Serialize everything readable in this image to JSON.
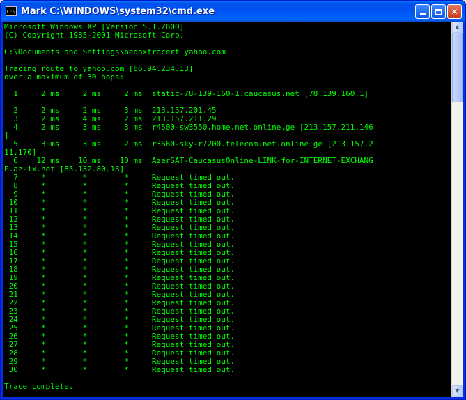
{
  "window": {
    "title": "Mark C:\\WINDOWS\\system32\\cmd.exe",
    "icon_label": "C:\\"
  },
  "console_lines": [
    "Microsoft Windows XP [Version 5.1.2600]",
    "(C) Copyright 1985-2001 Microsoft Corp.",
    "",
    "C:\\Documents and Settings\\beqa>tracert yahoo.com",
    "",
    "Tracing route to yahoo.com [66.94.234.13]",
    "over a maximum of 30 hops:",
    "",
    "  1     2 ms     2 ms     2 ms  static-78-139-160-1.caucasus.net [78.139.160.1]",
    "",
    "  2     2 ms     2 ms     3 ms  213.157.201.45",
    "  3     2 ms     4 ms     2 ms  213.157.211.29",
    "  4     2 ms     3 ms     3 ms  r4500-sw3550.home.net.online.ge [213.157.211.146",
    "]",
    "  5     3 ms     3 ms     2 ms  r3660-sky-r7200.telecom.net.online.ge [213.157.2",
    "11.170]",
    "  6    12 ms    10 ms    10 ms  AzerSAT-CaucasusOnline-LINK-for-INTERNET-EXCHANG",
    "E.az-ix.net [85.132.80.13]",
    "  7     *        *        *     Request timed out.",
    "  8     *        *        *     Request timed out.",
    "  9     *        *        *     Request timed out.",
    " 10     *        *        *     Request timed out.",
    " 11     *        *        *     Request timed out.",
    " 12     *        *        *     Request timed out.",
    " 13     *        *        *     Request timed out.",
    " 14     *        *        *     Request timed out.",
    " 15     *        *        *     Request timed out.",
    " 16     *        *        *     Request timed out.",
    " 17     *        *        *     Request timed out.",
    " 18     *        *        *     Request timed out.",
    " 19     *        *        *     Request timed out.",
    " 20     *        *        *     Request timed out.",
    " 21     *        *        *     Request timed out.",
    " 22     *        *        *     Request timed out.",
    " 23     *        *        *     Request timed out.",
    " 24     *        *        *     Request timed out.",
    " 25     *        *        *     Request timed out.",
    " 26     *        *        *     Request timed out.",
    " 27     *        *        *     Request timed out.",
    " 28     *        *        *     Request timed out.",
    " 29     *        *        *     Request timed out.",
    " 30     *        *        *     Request timed out.",
    "",
    "Trace complete."
  ],
  "colors": {
    "console_text": "#00ff00",
    "console_background": "#000000",
    "titlebar": "#0053ee"
  }
}
